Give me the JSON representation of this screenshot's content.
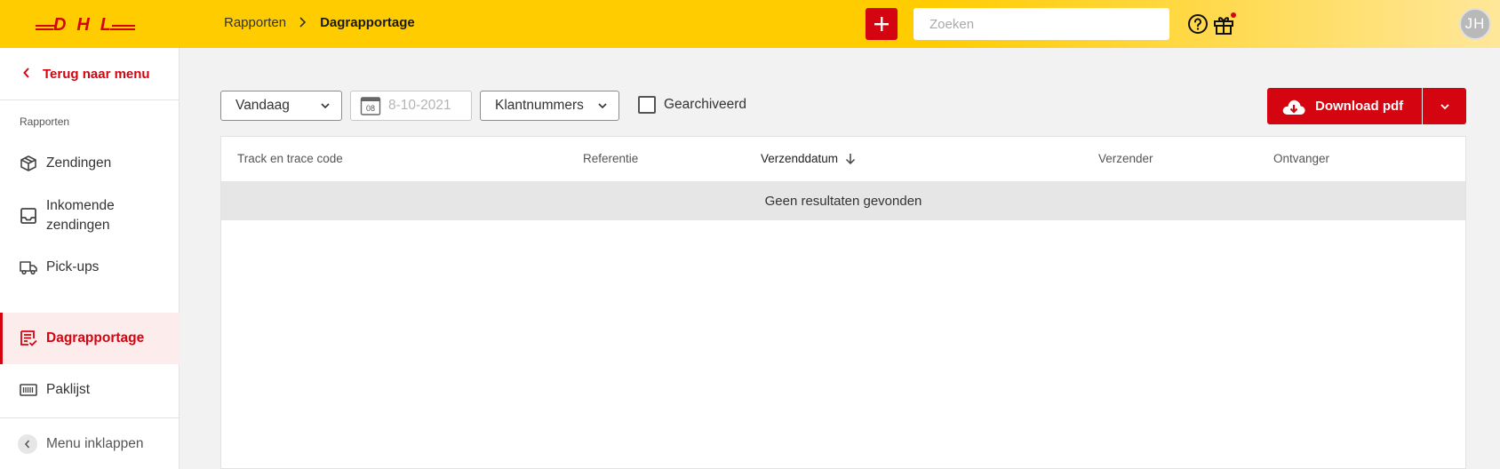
{
  "header": {
    "logo_text": "DHL",
    "breadcrumb": {
      "parent": "Rapporten",
      "current": "Dagrapportage"
    },
    "search_placeholder": "Zoeken",
    "avatar_initials": "JH"
  },
  "sidebar": {
    "back_label": "Terug naar menu",
    "section_label": "Rapporten",
    "items": [
      {
        "label": "Zendingen",
        "icon": "package-icon"
      },
      {
        "label": "Inkomende zendingen",
        "icon": "inbox-icon"
      },
      {
        "label": "Pick-ups",
        "icon": "truck-icon"
      },
      {
        "label": "Dagrapportage",
        "icon": "report-icon",
        "active": true
      },
      {
        "label": "Paklijst",
        "icon": "barcode-icon"
      }
    ],
    "collapse_label": "Menu inklappen"
  },
  "toolbar": {
    "period_select": "Vandaag",
    "date_value": "8-10-2021",
    "calendar_day": "08",
    "customer_select": "Klantnummers",
    "archived_label": "Gearchiveerd",
    "archived_checked": false,
    "download_label": "Download pdf"
  },
  "table": {
    "columns": [
      "Track en trace code",
      "Referentie",
      "Verzenddatum",
      "Verzender",
      "Ontvanger"
    ],
    "sorted_column": "Verzenddatum",
    "sort_direction": "descending",
    "empty_message": "Geen resultaten gevonden"
  },
  "colors": {
    "brand_yellow": "#ffcc00",
    "brand_red": "#d40511",
    "active_bg": "#fdecec"
  }
}
